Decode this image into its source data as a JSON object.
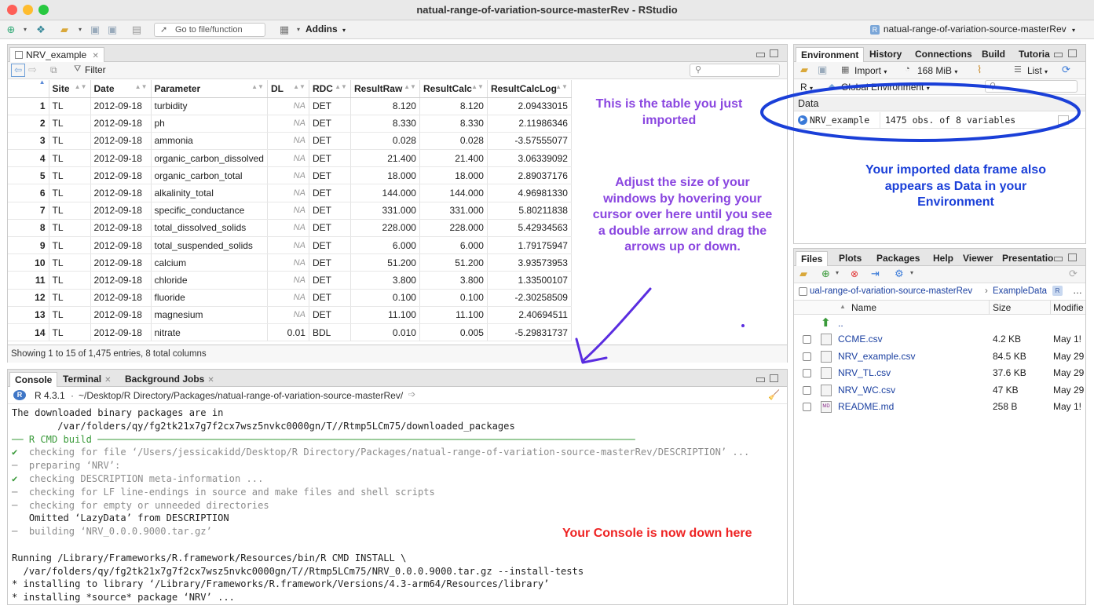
{
  "window": {
    "title": "natual-range-of-variation-source-masterRev - RStudio"
  },
  "toolbar": {
    "goto_label": "Go to file/function",
    "addins_label": "Addins",
    "project_name": "natual-range-of-variation-source-masterRev"
  },
  "source_pane": {
    "tab_label": "NRV_example",
    "filter_label": "Filter",
    "columns": [
      "Site",
      "Date",
      "Parameter",
      "DL",
      "RDC",
      "ResultRaw",
      "ResultCalc",
      "ResultCalcLog"
    ],
    "rows": [
      [
        "1",
        "TL",
        "2012-09-18",
        "turbidity",
        "NA",
        "DET",
        "8.120",
        "8.120",
        "2.09433015"
      ],
      [
        "2",
        "TL",
        "2012-09-18",
        "ph",
        "NA",
        "DET",
        "8.330",
        "8.330",
        "2.11986346"
      ],
      [
        "3",
        "TL",
        "2012-09-18",
        "ammonia",
        "NA",
        "DET",
        "0.028",
        "0.028",
        "-3.57555077"
      ],
      [
        "4",
        "TL",
        "2012-09-18",
        "organic_carbon_dissolved",
        "NA",
        "DET",
        "21.400",
        "21.400",
        "3.06339092"
      ],
      [
        "5",
        "TL",
        "2012-09-18",
        "organic_carbon_total",
        "NA",
        "DET",
        "18.000",
        "18.000",
        "2.89037176"
      ],
      [
        "6",
        "TL",
        "2012-09-18",
        "alkalinity_total",
        "NA",
        "DET",
        "144.000",
        "144.000",
        "4.96981330"
      ],
      [
        "7",
        "TL",
        "2012-09-18",
        "specific_conductance",
        "NA",
        "DET",
        "331.000",
        "331.000",
        "5.80211838"
      ],
      [
        "8",
        "TL",
        "2012-09-18",
        "total_dissolved_solids",
        "NA",
        "DET",
        "228.000",
        "228.000",
        "5.42934563"
      ],
      [
        "9",
        "TL",
        "2012-09-18",
        "total_suspended_solids",
        "NA",
        "DET",
        "6.000",
        "6.000",
        "1.79175947"
      ],
      [
        "10",
        "TL",
        "2012-09-18",
        "calcium",
        "NA",
        "DET",
        "51.200",
        "51.200",
        "3.93573953"
      ],
      [
        "11",
        "TL",
        "2012-09-18",
        "chloride",
        "NA",
        "DET",
        "3.800",
        "3.800",
        "1.33500107"
      ],
      [
        "12",
        "TL",
        "2012-09-18",
        "fluoride",
        "NA",
        "DET",
        "0.100",
        "0.100",
        "-2.30258509"
      ],
      [
        "13",
        "TL",
        "2012-09-18",
        "magnesium",
        "NA",
        "DET",
        "11.100",
        "11.100",
        "2.40694511"
      ],
      [
        "14",
        "TL",
        "2012-09-18",
        "nitrate",
        "0.01",
        "BDL",
        "0.010",
        "0.005",
        "-5.29831737"
      ]
    ],
    "status": "Showing 1 to 15 of 1,475 entries, 8 total columns"
  },
  "annotations": {
    "table_note": "This is the table you just imported",
    "resize_note": "Adjust the size of your windows by hovering your cursor over here until you see a double arrow and drag the arrows up or down.",
    "env_note": "Your imported data frame also appears as Data in your Environment",
    "console_note": "Your Console is now down here"
  },
  "env_pane": {
    "tabs": [
      "Environment",
      "History",
      "Connections",
      "Build",
      "Tutoria"
    ],
    "import_label": "Import",
    "memory_label": "168 MiB",
    "list_label": "List",
    "language_label": "R",
    "scope_label": "Global Environment",
    "section_label": "Data",
    "object_name": "NRV_example",
    "object_desc": "1475 obs. of 8 variables"
  },
  "files_pane": {
    "tabs": [
      "Files",
      "Plots",
      "Packages",
      "Help",
      "Viewer",
      "Presentatio"
    ],
    "path_part1": "ual-range-of-variation-source-masterRev",
    "path_part2": "ExampleData",
    "col_name": "Name",
    "col_size": "Size",
    "col_modified": "Modifie",
    "up_label": "..",
    "files": [
      {
        "name": "CCME.csv",
        "size": "4.2 KB",
        "modified": "May 1!"
      },
      {
        "name": "NRV_example.csv",
        "size": "84.5 KB",
        "modified": "May 29"
      },
      {
        "name": "NRV_TL.csv",
        "size": "37.6 KB",
        "modified": "May 29"
      },
      {
        "name": "NRV_WC.csv",
        "size": "47 KB",
        "modified": "May 29"
      },
      {
        "name": "README.md",
        "size": "258 B",
        "modified": "May 1!"
      }
    ]
  },
  "console_pane": {
    "tabs": [
      "Console",
      "Terminal",
      "Background Jobs"
    ],
    "r_version": "R 4.3.1",
    "path": "~/Desktop/R Directory/Packages/natual-range-of-variation-source-masterRev/",
    "lines": [
      {
        "text": "The downloaded binary packages are in",
        "style": "plain"
      },
      {
        "text": "        /var/folders/qy/fg2tk21x7g7f2cx7wsz5nvkc0000gn/T//Rtmp5LCm75/downloaded_packages",
        "style": "plain"
      },
      {
        "text": "── R CMD build ──────────────────────────────────────────────────────────────────────────────────────────────",
        "style": "green"
      },
      {
        "text": "✔  checking for file ‘/Users/jessicakidd/Desktop/R Directory/Packages/natual-range-of-variation-source-masterRev/DESCRIPTION’ ...",
        "style": "check"
      },
      {
        "text": "─  preparing ‘NRV’:",
        "style": "gray"
      },
      {
        "text": "✔  checking DESCRIPTION meta-information ...",
        "style": "check"
      },
      {
        "text": "─  checking for LF line-endings in source and make files and shell scripts",
        "style": "gray"
      },
      {
        "text": "─  checking for empty or unneeded directories",
        "style": "gray"
      },
      {
        "text": "   Omitted ‘LazyData’ from DESCRIPTION",
        "style": "plain"
      },
      {
        "text": "─  building ‘NRV_0.0.0.9000.tar.gz’",
        "style": "gray"
      },
      {
        "text": "",
        "style": "plain"
      },
      {
        "text": "Running /Library/Frameworks/R.framework/Resources/bin/R CMD INSTALL \\",
        "style": "plain"
      },
      {
        "text": "  /var/folders/qy/fg2tk21x7g7f2cx7wsz5nvkc0000gn/T//Rtmp5LCm75/NRV_0.0.0.9000.tar.gz --install-tests",
        "style": "plain"
      },
      {
        "text": "* installing to library ‘/Library/Frameworks/R.framework/Versions/4.3-arm64/Resources/library’",
        "style": "plain"
      },
      {
        "text": "* installing *source* package ‘NRV’ ...",
        "style": "plain"
      }
    ]
  },
  "colors": {
    "annotation_purple": "#8a46e0",
    "annotation_blue": "#1a3fd8",
    "annotation_red": "#ee2222",
    "console_green": "#3a9a3a"
  }
}
